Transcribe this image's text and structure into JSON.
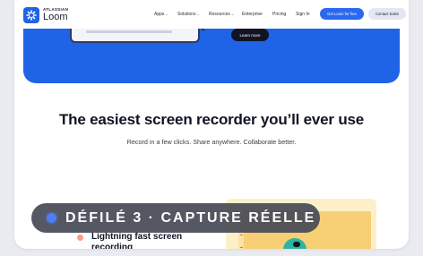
{
  "brand": {
    "top": "ATLASSIAN",
    "bottom": "Loom",
    "color": "#1f63e6"
  },
  "nav": {
    "links": [
      {
        "label": "Apps",
        "caret": "⌄"
      },
      {
        "label": "Solutions",
        "caret": "⌄"
      },
      {
        "label": "Resources",
        "caret": "⌄"
      },
      {
        "label": "Enterprise"
      },
      {
        "label": "Pricing"
      },
      {
        "label": "Sign In"
      }
    ],
    "cta_primary": "Get Loom for free",
    "cta_secondary": "Contact Sales"
  },
  "hero": {
    "learn_more": "Learn more",
    "bg_color": "#1f63e6"
  },
  "main": {
    "headline": "The easiest screen recorder you’ll ever use",
    "subhead": "Record in a few clicks. Share anywhere. Collaborate better."
  },
  "feature": {
    "title": "Lightning fast screen recording"
  },
  "overlay": {
    "text": "DÉFILÉ 3 · CAPTURE RÉELLE",
    "dot_color": "#4d7ff2"
  }
}
